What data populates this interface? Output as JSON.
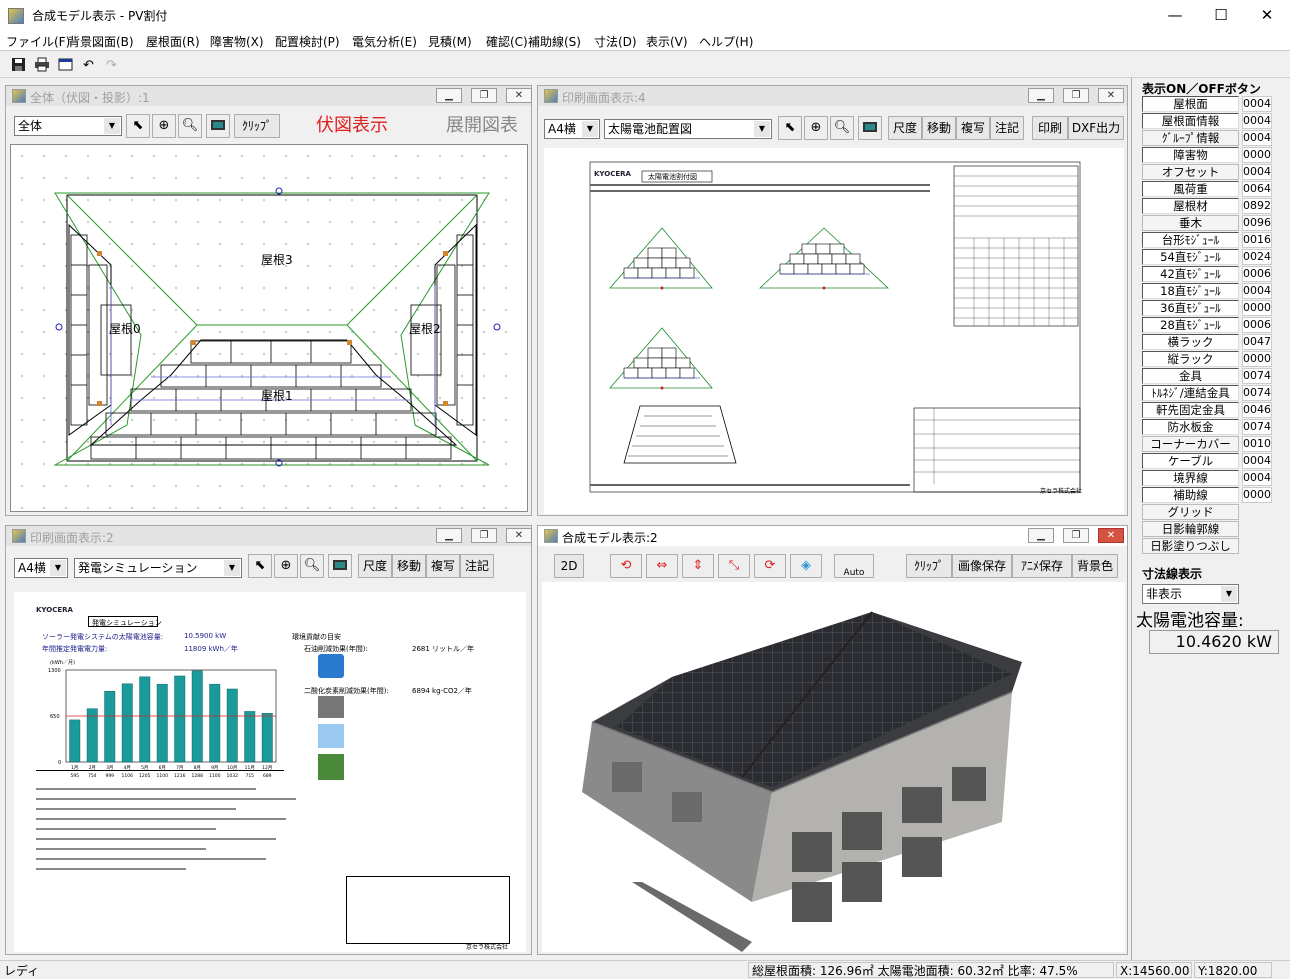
{
  "window": {
    "title": "合成モデル表示 - PV割付",
    "minimize": "—",
    "maximize": "☐",
    "close": "✕"
  },
  "menu": [
    "ファイル(F)",
    "背景図面(B)",
    "屋根面(R)",
    "障害物(X)",
    "配置検討(P)",
    "電気分析(E)",
    "見積(M)",
    "確認(C)",
    "補助線(S)",
    "寸法(D)",
    "表示(V)",
    "ヘルプ(H)"
  ],
  "toolbar_icons": [
    "save-icon",
    "print-icon",
    "window-icon",
    "undo-icon",
    "redo-icon"
  ],
  "panel_overall": {
    "title": "全体（伏図・投影）:1",
    "select": "全体",
    "clip": "ｸﾘｯﾌﾟ",
    "mode_active": "伏図表示",
    "mode_inactive": "展開図表",
    "roofs": [
      "屋根3",
      "屋根0",
      "屋根2",
      "屋根1"
    ]
  },
  "panel_print4": {
    "title": "印刷画面表示:4",
    "paper": "A4横",
    "layout": "太陽電池配置図",
    "buttons": [
      "尺度",
      "移動",
      "複写",
      "注記",
      "印刷",
      "DXF出力"
    ],
    "sheet_title": "太陽電池割付図",
    "company": "京セラ株式会社"
  },
  "panel_print2": {
    "title": "印刷画面表示:2",
    "paper": "A4横",
    "layout": "発電シミュレーション",
    "buttons": [
      "尺度",
      "移動",
      "複写",
      "注記"
    ],
    "sheet_title": "発電シミュレーション",
    "capacity_label": "ソーラー発電システムの太陽電池容量:",
    "capacity_value": "10.5900 kW",
    "annual_label": "年間推定発電電力量:",
    "annual_value": "11809 kWh／年",
    "env_title": "環境貢献の目安",
    "oil_label": "石油削減効果(年間):",
    "oil_value": "2681 リットル／年",
    "co2_label": "二酸化炭素削減効果(年間):",
    "co2_value": "6894 kg-CO2／年",
    "company": "京セラ株式会社"
  },
  "panel_model": {
    "title": "合成モデル表示:2",
    "btn_2d": "2D",
    "buttons": [
      "ｸﾘｯﾌﾟ",
      "画像保存",
      "ｱﾆﾒ保存",
      "背景色"
    ],
    "auto": "Auto"
  },
  "right_panel": {
    "header": "表示ON／OFFボタン",
    "items": [
      {
        "label": "屋根面",
        "count": "0004"
      },
      {
        "label": "屋根面情報",
        "count": "0004"
      },
      {
        "label": "ｸﾞﾙｰﾌﾟ情報",
        "count": "0004"
      },
      {
        "label": "障害物",
        "count": "0000"
      },
      {
        "label": "オフセット",
        "count": "0004"
      },
      {
        "label": "風荷重",
        "count": "0064"
      },
      {
        "label": "屋根材",
        "count": "0892"
      },
      {
        "label": "垂木",
        "count": "0096"
      },
      {
        "label": "台形ﾓｼﾞｭｰﾙ",
        "count": "0016"
      },
      {
        "label": "54直ﾓｼﾞｭｰﾙ",
        "count": "0024"
      },
      {
        "label": "42直ﾓｼﾞｭｰﾙ",
        "count": "0006"
      },
      {
        "label": "18直ﾓｼﾞｭｰﾙ",
        "count": "0004"
      },
      {
        "label": "36直ﾓｼﾞｭｰﾙ",
        "count": "0000"
      },
      {
        "label": "28直ﾓｼﾞｭｰﾙ",
        "count": "0006"
      },
      {
        "label": "横ラック",
        "count": "0047"
      },
      {
        "label": "縦ラック",
        "count": "0000"
      },
      {
        "label": "金具",
        "count": "0074"
      },
      {
        "label": "ﾄﾙﾈｼﾞ/連結金具",
        "count": "0074"
      },
      {
        "label": "軒先固定金具",
        "count": "0046"
      },
      {
        "label": "防水板金",
        "count": "0074"
      },
      {
        "label": "コーナーカバー",
        "count": "0010"
      },
      {
        "label": "ケーブル",
        "count": "0004"
      },
      {
        "label": "境界線",
        "count": "0004"
      },
      {
        "label": "補助線",
        "count": "0000"
      },
      {
        "label": "グリッド",
        "count": ""
      },
      {
        "label": "日影輪郭線",
        "count": ""
      },
      {
        "label": "日影塗りつぶし",
        "count": ""
      }
    ],
    "dim_label": "寸法線表示",
    "dim_select": "非表示",
    "capacity_label": "太陽電池容量:",
    "capacity_value": "10.4620 kW"
  },
  "status": {
    "ready": "レディ",
    "area": "総屋根面積:   126.96㎡  太陽電池面積:    60.32㎡  比率:  47.5%",
    "x": "X:14560.00",
    "y": "Y:1820.00"
  },
  "chart_data": {
    "type": "bar",
    "categories": [
      "1月",
      "2月",
      "3月",
      "4月",
      "5月",
      "6月",
      "7月",
      "8月",
      "9月",
      "10月",
      "11月",
      "12月"
    ],
    "values": [
      595,
      754,
      999,
      1106,
      1205,
      1100,
      1216,
      1288,
      1100,
      1032,
      715,
      689
    ],
    "ylabel": "(kWh／月)",
    "ylim": [
      0,
      1300
    ],
    "y_ticks": [
      "1300",
      "650",
      "0"
    ],
    "color": "#1a9a9a"
  }
}
